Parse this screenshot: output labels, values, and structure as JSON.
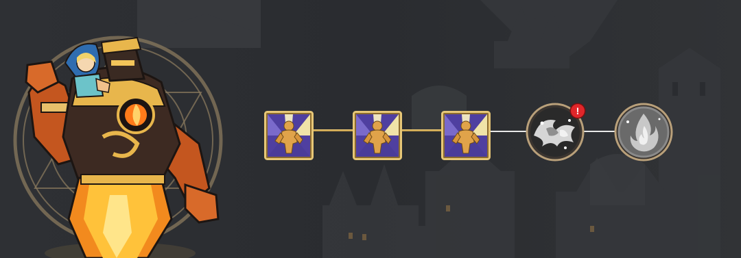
{
  "screen": {
    "background_color": "#2b2d31",
    "accent_gold": "#d9b45c",
    "locked_line_color": "#e9e9e9",
    "alert_color": "#e0262a"
  },
  "hero": {
    "portrait_icon": "fire-golem-hero-portrait-icon",
    "emblem_icon": "magic-circle-emblem-icon"
  },
  "upgrade_path": {
    "nodes": [
      {
        "icon": "strength-figure-icon",
        "state": "unlocked",
        "shape": "square"
      },
      {
        "icon": "strength-figure-icon",
        "state": "unlocked",
        "shape": "square"
      },
      {
        "icon": "strength-figure-icon",
        "state": "unlocked",
        "shape": "square"
      },
      {
        "icon": "wave-spirit-icon",
        "state": "locked",
        "shape": "circle",
        "alert": true
      },
      {
        "icon": "flame-icon",
        "state": "locked",
        "shape": "circle"
      }
    ],
    "alert_badge_text": "!"
  }
}
